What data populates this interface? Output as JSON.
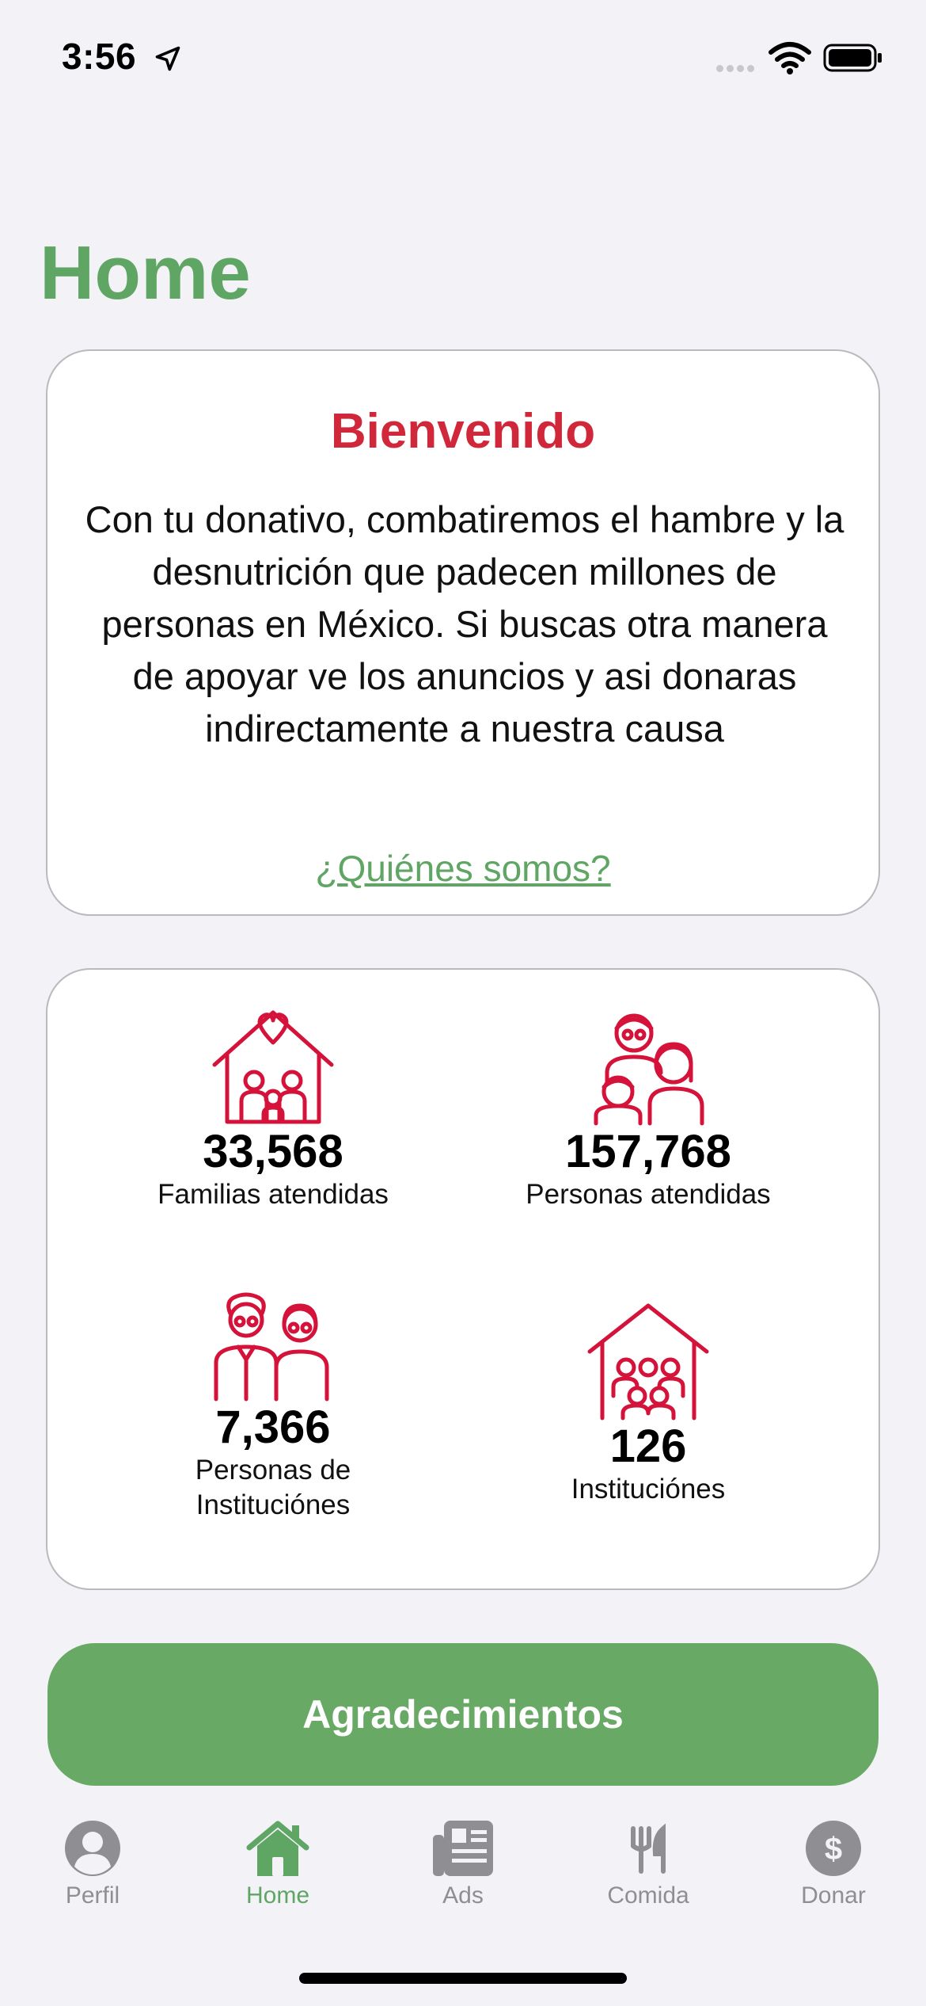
{
  "status_bar": {
    "time": "3:56"
  },
  "page_title": "Home",
  "welcome": {
    "title": "Bienvenido",
    "text": "Con tu donativo, combatiremos el hambre y la desnutrición que padecen millones de personas en México. Si buscas otra manera de apoyar ve los anuncios y asi donaras indirectamente a nuestra causa",
    "link": "¿Quiénes somos?"
  },
  "stats": [
    {
      "icon": "house-heart-family-icon",
      "number": "33,568",
      "label": "Familias atendidas"
    },
    {
      "icon": "family-people-icon",
      "number": "157,768",
      "label": "Personas atendidas"
    },
    {
      "icon": "elderly-couple-icon",
      "number": "7,366",
      "label": "Personas de Instituciónes"
    },
    {
      "icon": "institution-house-icon",
      "number": "126",
      "label": "Instituciónes"
    }
  ],
  "thanks_button": "Agradecimientos",
  "tabs": [
    {
      "label": "Perfil",
      "icon": "person-circle-icon",
      "active": false
    },
    {
      "label": "Home",
      "icon": "house-icon",
      "active": true
    },
    {
      "label": "Ads",
      "icon": "newspaper-icon",
      "active": false
    },
    {
      "label": "Comida",
      "icon": "fork-knife-icon",
      "active": false
    },
    {
      "label": "Donar",
      "icon": "dollar-circle-icon",
      "active": false
    }
  ],
  "colors": {
    "accent_green": "#5fa564",
    "button_green": "#68a965",
    "title_red": "#d0283a",
    "icon_red": "#d5123a",
    "tab_gray": "#8e8e93"
  }
}
